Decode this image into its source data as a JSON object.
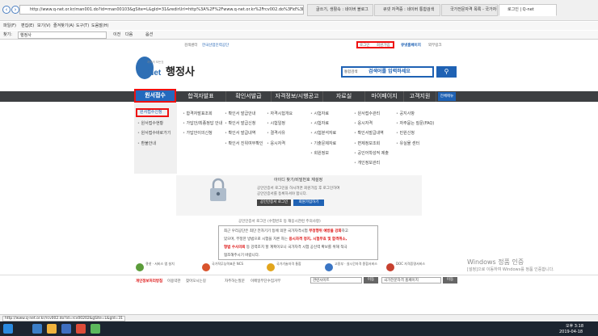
{
  "browser": {
    "address": "http://www.q-net.or.kr/man001.do?id=man00103&gSite=L&gId=31&redirUrl=http%3A%2F%2Fwww.q-net.or.kr%2Frcv002.do%3Fid%3Drcv00202%2...",
    "tabs": [
      "글쓰기, 생활속 : 네이버 블로그",
      "큐넷 자격증 : 네이버 통합검색",
      "국가전문자격 목록 - 국가자격...",
      "로그인 | Q-net"
    ],
    "menu": [
      "파일(F)",
      "편집(E)",
      "보기(V)",
      "즐겨찾기(A)",
      "도구(T)",
      "도움말(H)"
    ],
    "toolbar": [
      "홈(M)",
      "피드 읽기",
      "메일 읽기",
      "인쇄(R)",
      "페이지(P)",
      "안전(S)",
      "도구(O)",
      "도움말(H)"
    ],
    "find_label": "찾기:",
    "find_value": "행정사",
    "find_prev": "이전",
    "find_next": "다음",
    "find_options": "옵션",
    "status_url": "http://www.q-net.or.kr/rcv002.do?id=rcv00202&gSite=L&gId=31"
  },
  "page": {
    "top_left": [
      "검색센터",
      "한국산업인력공단"
    ],
    "top_right": [
      "로그인",
      "회원가입",
      "큐넷홈페이지",
      "외부링크"
    ],
    "logo_text": "Q-Net",
    "logo_sub": "자격의 모든것",
    "title": "행정사",
    "search_scope": "통합검색",
    "search_placeholder": "검색어를 입력하세요",
    "nav": [
      "원서접수",
      "합격자발표",
      "확인서발급",
      "자격정보/시행공고",
      "자료실",
      "마이페이지",
      "고객지원"
    ],
    "allmenu": "전체메뉴",
    "submenu": {
      "col1": [
        "원서접수신청",
        "원서접수현황",
        "원서접수바로가기",
        "환불안내"
      ],
      "col2": [
        "합격자발표조회",
        "가답안/최종정답 안내",
        "가답안이의신청"
      ],
      "col3": [
        "확인서 발급안내",
        "확인서 발급신청",
        "확인서 발급내역",
        "확인서 진위여부확인"
      ],
      "col4": [
        "자격시험개요",
        "시험일정",
        "결격사유",
        "응시자격"
      ],
      "col5": [
        "시험자료",
        "시험자료",
        "시험분석자료",
        "기출문제자료",
        "회원정보"
      ],
      "col6": [
        "원서접수관리",
        "응시자격",
        "확인서발급내역",
        "면제정보조회",
        "공인어학성적 제출",
        "개인정보관리"
      ],
      "col7": [
        "공지사항",
        "자주묻는 질문(FAQ)",
        "민원신청",
        "유실물 센터"
      ]
    },
    "login": {
      "title": "아이디 찾기/비밀번호 재설정",
      "desc1": "공인인증서 로그인을 하시려면 회원가입 후 로그인하여",
      "desc2": "공인인증서를 등록하셔야 합니다.",
      "cert_btn": "공인인증서 로그인",
      "join_btn": "회원가입하기"
    },
    "notice_line": "공인인증서 로그인 (수험번호 등 재응시관련 주의사항)",
    "notice": {
      "l1a": "최근 우리공단은 최단 전자기기 등에 의한 국가자격시험 ",
      "l1b": "부정행위 예방을 강화",
      "l1c": "하고",
      "l2": "있으며, 부정한 방법으로 시험을 치른 자는",
      "l2b": " 응시자격 정지, 시험무효 및 합격취소,",
      "l3a": "형법 수사의뢰",
      "l3b": " 등 강력조치 할 계획이오니 국가자격 시험 공신력 확보를 위해 적극",
      "l4": "협조해주시기 바랍니다."
    },
    "footer": {
      "links": [
        "개인정보처리방침",
        "이용약관",
        "찾아오시는길",
        "자주하는질문",
        "이메일무단수집거부"
      ],
      "select1": "관련사이트",
      "select2": "국가전문자격 홈페이지",
      "go": "이동"
    },
    "banners": [
      "큐넷 · 서비스 앱 설치",
      "국가직무능력표준 NCS",
      "국가기술자격 통합",
      "고용부 · 실시간자격 종합서비스",
      "DOC 자격증명서비스"
    ],
    "watermark1": "Windows 정품 인증",
    "watermark2": "[설정]으로 이동하여 Windows를 정품 인증합니다."
  },
  "taskbar": {
    "time": "오후 3:18",
    "date": "2019-04-18"
  }
}
